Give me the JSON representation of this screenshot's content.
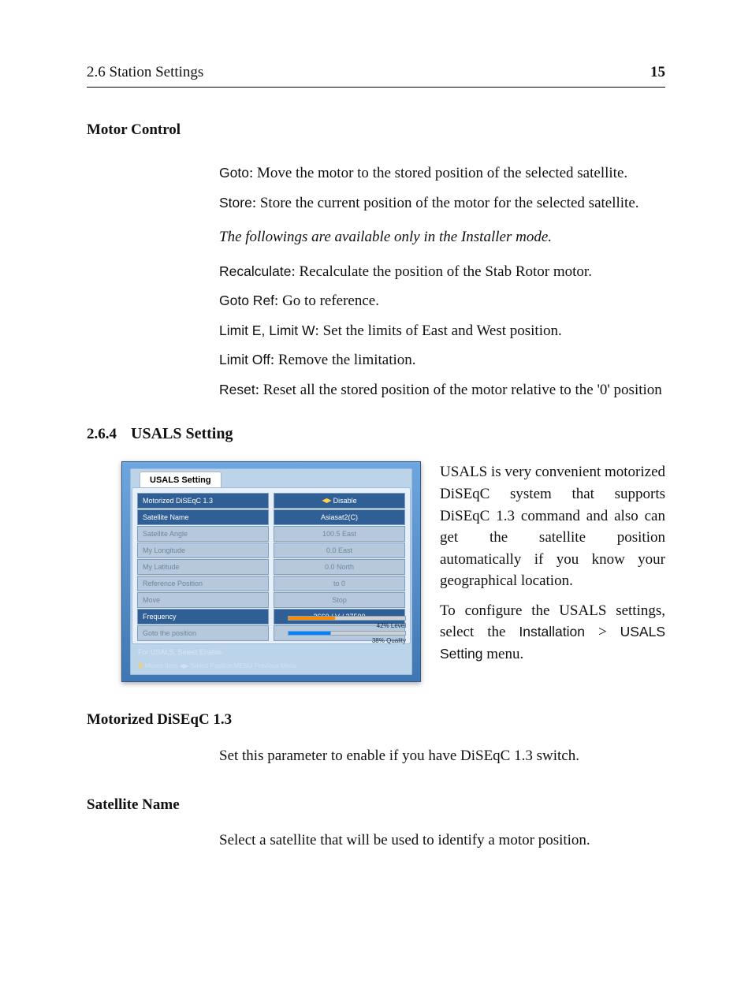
{
  "header": {
    "left": "2.6 Station Settings",
    "right": "15"
  },
  "h3_motor_control": "Motor Control",
  "motor": {
    "goto_term": "Goto",
    "goto_desc": ":  Move the motor to the stored position of the selected satellite.",
    "store_term": "Store",
    "store_desc": ":  Store the current position of the motor for the selected satellite.",
    "note": "The followings are available only in the Installer mode.",
    "recalc_term": "Recalculate",
    "recalc_desc": ":  Recalculate the position of the Stab Rotor motor.",
    "gotoref_term": "Goto Ref",
    "gotoref_desc": ":  Go to reference.",
    "limitew_term": "Limit E, Limit W",
    "limitew_desc": ":  Set the limits of East and West position.",
    "limitoff_term": "Limit Off",
    "limitoff_desc": ":  Remove the limitation.",
    "reset_term": "Reset",
    "reset_desc": ":  Reset all the stored position of the motor relative to the '0' position"
  },
  "subsection": {
    "num": "2.6.4",
    "title": "USALS Setting"
  },
  "usals_para1": "USALS is very convenient motorized DiSEqC system that supports DiSEqC 1.3 command and also can get the satellite position automatically if you know your geographical location.",
  "usals_para2_a": "To configure the USALS settings, select the ",
  "usals_para2_b": "Installation",
  "usals_para2_c": " > ",
  "usals_para2_d": "USALS Setting",
  "usals_para2_e": " menu.",
  "shot": {
    "tab": "USALS Setting",
    "rows": [
      {
        "l": "Motorized DiSEqC 1.3",
        "r_prefix": "◀▶ ",
        "r": "Disable",
        "dim": false
      },
      {
        "l": "Satellite Name",
        "r_prefix": "",
        "r": "Asiasat2(C)",
        "dim": false
      },
      {
        "l": "Satellite Angle",
        "r_prefix": "",
        "r": "100.5 East",
        "dim": true
      },
      {
        "l": "My Longitude",
        "r_prefix": "",
        "r": "0.0 East",
        "dim": true
      },
      {
        "l": "My Latitude",
        "r_prefix": "",
        "r": "0.0 North",
        "dim": true
      },
      {
        "l": "Reference Position",
        "r_prefix": "",
        "r": "to 0",
        "dim": true
      },
      {
        "l": "Move",
        "r_prefix": "",
        "r": "Stop",
        "dim": true
      },
      {
        "l": "Frequency",
        "r_prefix": "",
        "r": "3660 / V / 27500",
        "dim": false
      },
      {
        "l": "Goto the position",
        "r_prefix": "",
        "r": "",
        "dim": true
      }
    ],
    "level_label": "42%  Level",
    "quality_label": "38%  Quality",
    "hint": "For USALS, Select Enable.",
    "hintbar": "Moves Item  ◀▶ Select Position  MENU Previous Menu"
  },
  "param1_h": "Motorized DiSEqC 1.3",
  "param1_body": "Set this parameter to enable if you have DiSEqC 1.3 switch.",
  "param2_h": "Satellite Name",
  "param2_body": "Select a satellite that will be used to identify a motor position."
}
